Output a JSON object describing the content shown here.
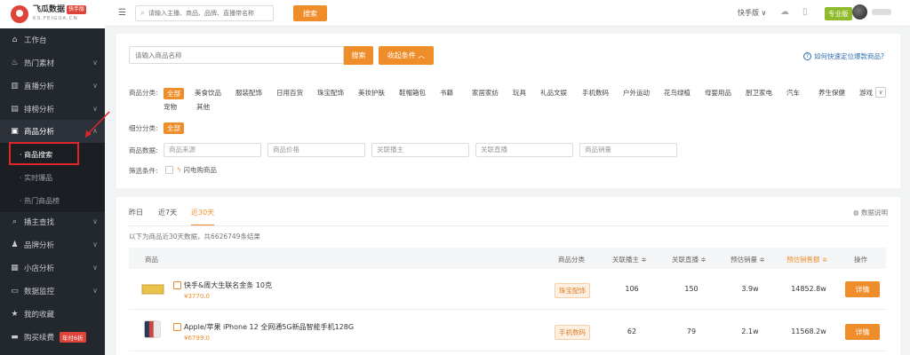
{
  "brand": {
    "title": "飞瓜数据",
    "badge": "快手版",
    "subtitle": "KS.FEIGUA.CN"
  },
  "sidebar": {
    "items": [
      {
        "label": "工作台",
        "icon": "home-icon"
      },
      {
        "label": "热门素材",
        "icon": "flame-icon"
      },
      {
        "label": "直播分析",
        "icon": "chart-icon"
      },
      {
        "label": "排榜分析",
        "icon": "ranking-icon"
      },
      {
        "label": "商品分析",
        "icon": "bag-icon"
      },
      {
        "label": "播主查找",
        "icon": "search-icon"
      },
      {
        "label": "品牌分析",
        "icon": "brand-icon"
      },
      {
        "label": "小店分析",
        "icon": "store-icon"
      },
      {
        "label": "数据监控",
        "icon": "monitor-icon"
      },
      {
        "label": "我的收藏",
        "icon": "star-icon"
      },
      {
        "label": "购买续费",
        "icon": "cart-icon",
        "badge": "年付6折"
      }
    ],
    "subitems": [
      {
        "label": "· 商品搜索"
      },
      {
        "label": "· 实时爆品"
      },
      {
        "label": "· 热门商品榜"
      }
    ]
  },
  "topbar": {
    "search_placeholder": "请输入主播、商品、品牌、直播带名称",
    "search_button": "搜索",
    "platform": "快手版 ∨",
    "pro_badge": "专业版"
  },
  "filters": {
    "search_placeholder": "请输入商品名称",
    "search_button": "搜索",
    "collapse_button": "收起条件 ︿",
    "help": "如何快速定位爆款商品?",
    "category_label": "商品分类:",
    "categories": [
      "全部",
      "美食饮品",
      "服装配饰",
      "日用百货",
      "珠宝配饰",
      "美妆护肤",
      "鞋帽箱包",
      "书籍",
      "家居家纺",
      "玩具",
      "礼品文娱",
      "手机数码",
      "户外运动",
      "花鸟绿植",
      "母婴用品",
      "厨卫家电",
      "汽车",
      "养生保健",
      "游戏",
      "宠物",
      "其他"
    ],
    "subcategory_label": "细分分类:",
    "subcategory_all": "全部",
    "data_label": "商品数据:",
    "selects": [
      "商品来源",
      "商品价格",
      "关联播主",
      "关联直播",
      "商品销量"
    ],
    "screen_label": "筛选条件:",
    "flash_option": "闪电购商品"
  },
  "results": {
    "tabs": [
      "昨日",
      "近7天",
      "近30天"
    ],
    "active_tab": "近30天",
    "data_note": "数据说明",
    "summary": "以下为商品近30天数据，共6626749条结果",
    "columns": [
      "商品",
      "商品分类",
      "关联播主 ≑",
      "关联直播 ≑",
      "预估销量 ≑",
      "预估销售额 ≑",
      "操作"
    ],
    "rows": [
      {
        "name": "快手&周大生联名金条 10克",
        "price": "¥3770.0",
        "category": "珠宝配饰",
        "anchors": "106",
        "lives": "150",
        "sales": "3.9w",
        "revenue": "14852.8w",
        "action": "详情"
      },
      {
        "name": "Apple/苹果 iPhone 12 全网通5G新品智能手机128G",
        "price": "¥6799.0",
        "category": "手机数码",
        "anchors": "62",
        "lives": "79",
        "sales": "2.1w",
        "revenue": "11568.2w",
        "action": "详情"
      }
    ]
  },
  "colors": {
    "accent": "#f08d2b",
    "sidebar_bg": "#23272e",
    "annotation": "#e0262a"
  }
}
